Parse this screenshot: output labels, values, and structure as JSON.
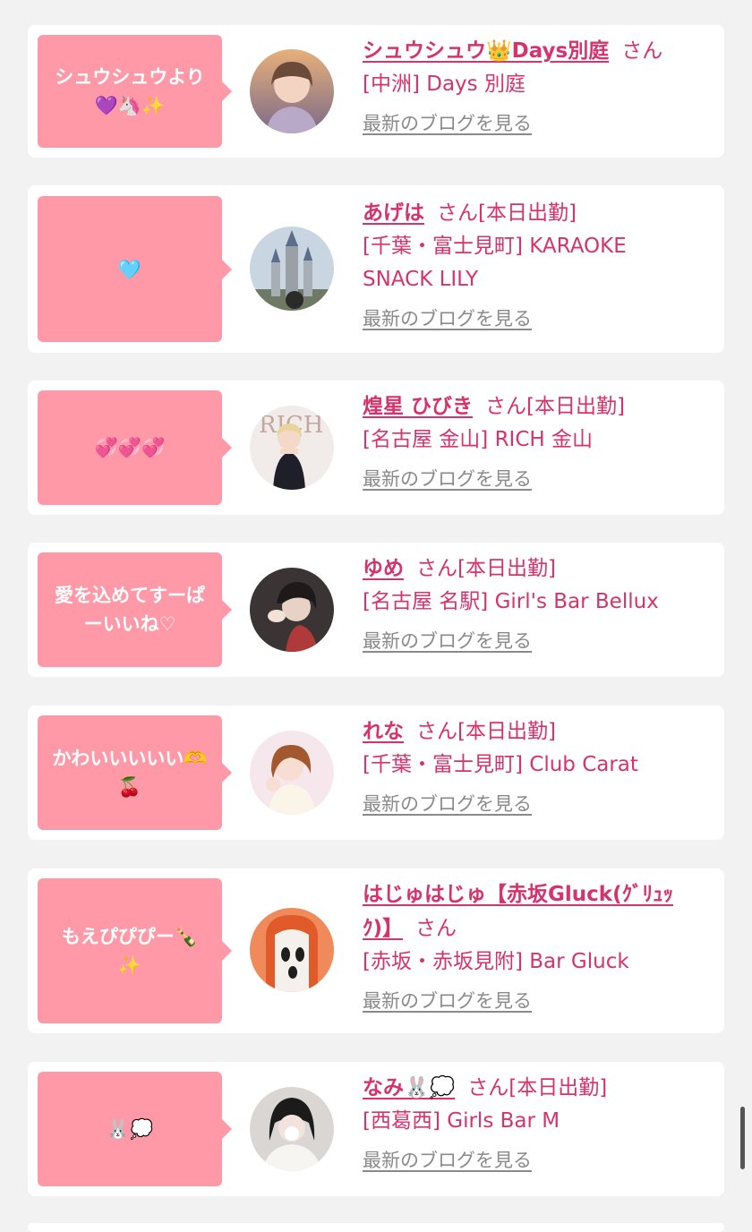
{
  "colors": {
    "background": "#f2f2f2",
    "bubble": "#ff98a7",
    "accent": "#d6336c",
    "link_gray": "#8a8a8a"
  },
  "cards": [
    {
      "message": "シュウシュウより\n💜🦄✨",
      "name": "シュウシュウ👑Days別庭",
      "san": "さん",
      "shop": "[中洲] Days 別庭",
      "blog": "最新のブログを見る",
      "avatar": "avatar-sunset"
    },
    {
      "message": "🩵",
      "name": "あげは",
      "san": "さん[本日出勤]",
      "shop": "[千葉・富士見町] KARAOKE SNACK LILY",
      "blog": "最新のブログを見る",
      "avatar": "avatar-castle"
    },
    {
      "message": "💞💞💞",
      "name": "煌星 ひびき",
      "san": "さん[本日出勤]",
      "shop": "[名古屋 金山] RICH 金山",
      "blog": "最新のブログを見る",
      "avatar": "avatar-bunny-girl"
    },
    {
      "message": "愛を込めてすーぱ\nーいいね♡",
      "name": "ゆめ",
      "san": "さん[本日出勤]",
      "shop": "[名古屋 名駅] Girl's Bar Bellux",
      "blog": "最新のブログを見る",
      "avatar": "avatar-dark-photo"
    },
    {
      "message": "かわいいいいい🫶\n🍒",
      "name": "れな",
      "san": "さん[本日出勤]",
      "shop": "[千葉・富士見町] Club Carat",
      "blog": "最新のブログを見る",
      "avatar": "avatar-white-dress"
    },
    {
      "message": "もえぴぴぴー🍾\n✨",
      "name": "はじゅはじゅ【赤坂Gluck(ｸﾞﾘｭｯｸ)】",
      "san": "さん",
      "shop": "[赤坂・赤坂見附] Bar Gluck",
      "blog": "最新のブログを見る",
      "avatar": "avatar-cartoon"
    },
    {
      "message": "🐰💭",
      "name": "なみ🐰💭",
      "san": "さん[本日出勤]",
      "shop": "[西葛西] Girls Bar M",
      "blog": "最新のブログを見る",
      "avatar": "avatar-fur-coat"
    }
  ]
}
